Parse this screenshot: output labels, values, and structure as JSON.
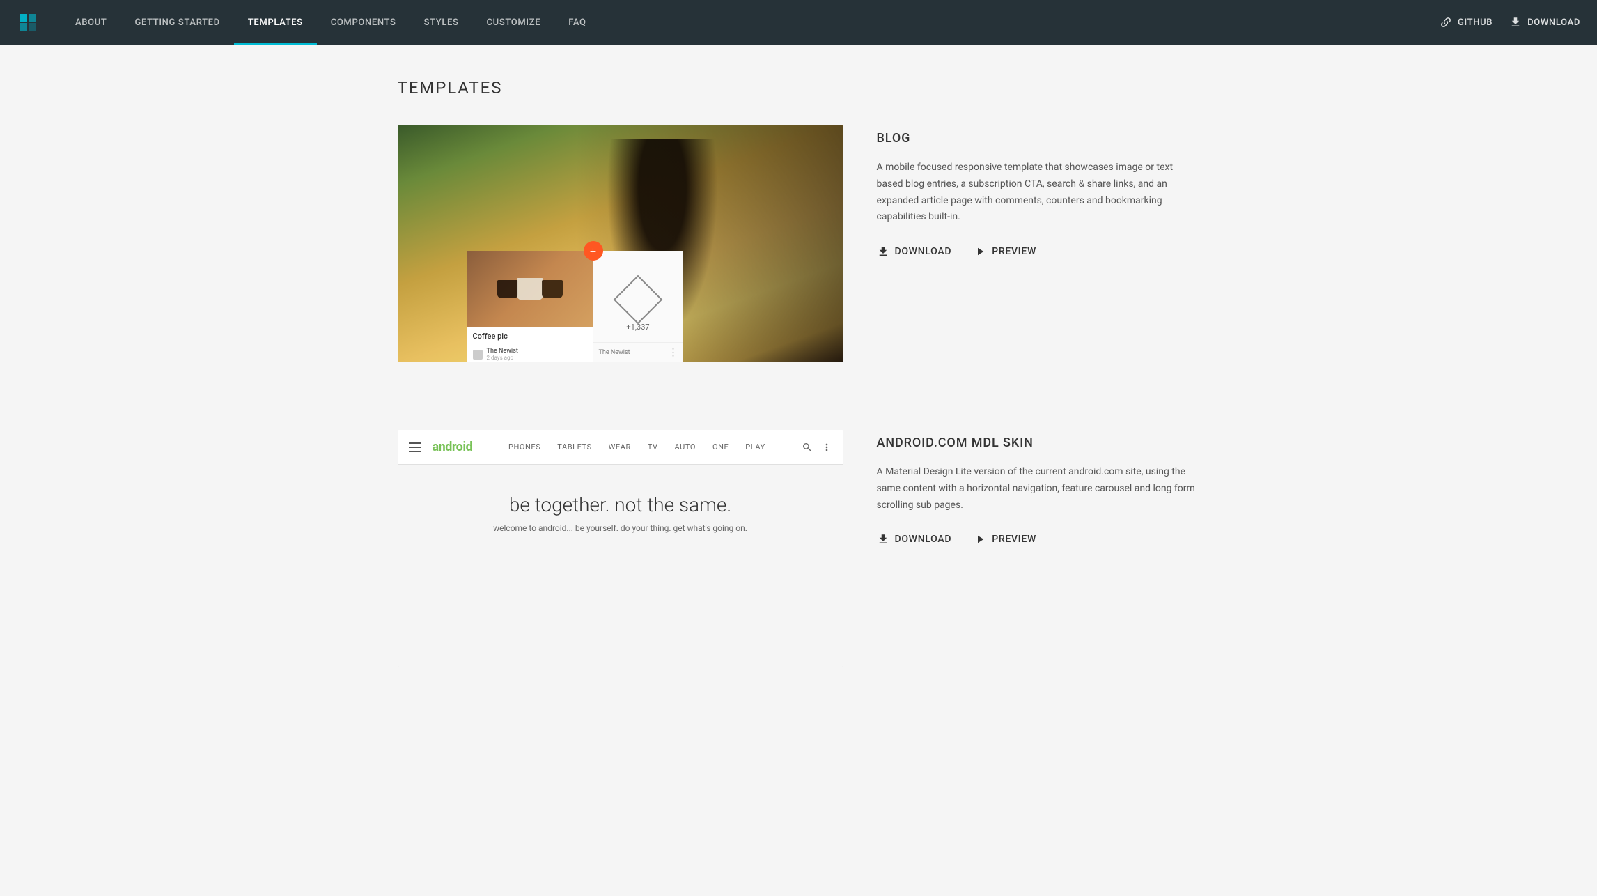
{
  "header": {
    "logo_alt": "MDL Logo",
    "nav_items": [
      {
        "id": "about",
        "label": "ABOUT",
        "active": false
      },
      {
        "id": "getting-started",
        "label": "GETTING STARTED",
        "active": false
      },
      {
        "id": "templates",
        "label": "TEMPLATES",
        "active": true
      },
      {
        "id": "components",
        "label": "COMPONENTS",
        "active": false
      },
      {
        "id": "styles",
        "label": "STYLES",
        "active": false
      },
      {
        "id": "customize",
        "label": "CUSTOMIZE",
        "active": false
      },
      {
        "id": "faq",
        "label": "FAQ",
        "active": false
      }
    ],
    "github_label": "GitHub",
    "download_label": "Download"
  },
  "main": {
    "page_title": "TEMPLATES",
    "templates": [
      {
        "id": "blog",
        "name": "BLOG",
        "description": "A mobile focused responsive template that showcases image or text based blog entries, a subscription CTA, search & share links, and an expanded article page with comments, counters and bookmarking capabilities built-in.",
        "download_label": "Download",
        "preview_label": "Preview",
        "preview_card_label": "Coffee pic",
        "preview_count": "+1,337",
        "preview_caption": "The Newist",
        "preview_caption2": "2 days ago",
        "preview_caption3": "The Newist"
      },
      {
        "id": "android",
        "name": "ANDROID.COM MDL SKIN",
        "description": "A Material Design Lite version of the current android.com site, using the same content with a horizontal navigation, feature carousel and long form scrolling sub pages.",
        "download_label": "Download",
        "preview_label": "Preview",
        "android_logo": "android",
        "android_nav": [
          "PHONES",
          "TABLETS",
          "WEAR",
          "TV",
          "AUTO",
          "ONE",
          "PLAY"
        ],
        "android_hero_title": "be together. not the same.",
        "android_hero_sub": "welcome to android... be yourself. do your thing. get what's going on."
      }
    ]
  }
}
